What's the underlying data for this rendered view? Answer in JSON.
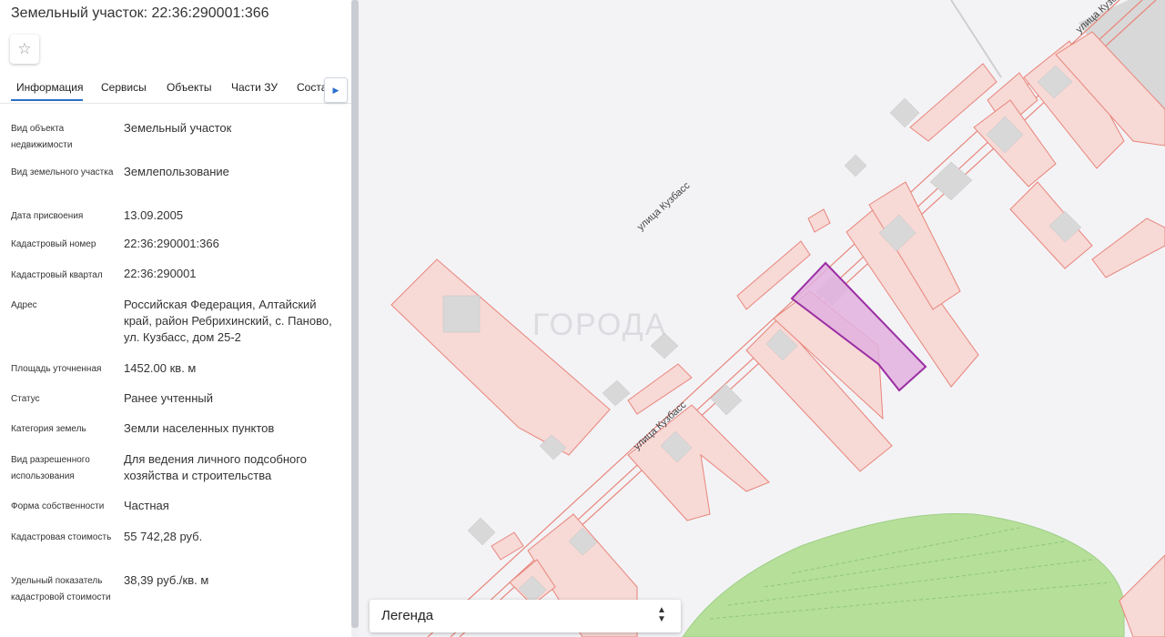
{
  "panel": {
    "title": "Земельный участок: 22:36:290001:366",
    "favorite_icon": "star-icon",
    "tabs": [
      "Информация",
      "Сервисы",
      "Объекты",
      "Части ЗУ",
      "Соста"
    ],
    "tab_scroll_icon": "triangle-right-icon",
    "active_tab": "Информация",
    "fields": [
      {
        "label": "Вид объекта недвижимости",
        "value": "Земельный участок"
      },
      {
        "label": "Вид земельного участка",
        "value": "Землепользование"
      },
      {
        "label": "Дата присвоения",
        "value": "13.09.2005"
      },
      {
        "label": "Кадастровый номер",
        "value": "22:36:290001:366"
      },
      {
        "label": "Кадастровый квартал",
        "value": "22:36:290001"
      },
      {
        "label": "Адрес",
        "value": "Российская Федерация, Алтайский край, район Ребрихинский, с. Паново, ул. Кузбасс, дом 25-2"
      },
      {
        "label": "Площадь уточненная",
        "value": "1452.00 кв. м"
      },
      {
        "label": "Статус",
        "value": "Ранее учтенный"
      },
      {
        "label": "Категория земель",
        "value": "Земли населенных пунктов"
      },
      {
        "label": "Вид разрешенного использования",
        "value": "Для ведения личного подсобного хозяйства и строительства"
      },
      {
        "label": "Форма собственности",
        "value": "Частная"
      },
      {
        "label": "Кадастровая стоимость",
        "value": "55 742,28 руб."
      },
      {
        "label": "Удельный показатель кадастровой стоимости",
        "value": "38,39 руб./кв. м"
      }
    ]
  },
  "map": {
    "street_labels": [
      "улица Кузбасс",
      "улица Кузбасс",
      "улица Кузбасс"
    ],
    "watermark": "ГОРОДА",
    "legend_label": "Легенда",
    "legend_icon": "chevron-up-down-icon",
    "colors": {
      "parcel_fill": "#f7d9d6",
      "parcel_stroke": "#e8857a",
      "selected_fill": "#e2b0df",
      "selected_stroke": "#9b2fa3",
      "building": "#d8d8d8",
      "forest": "#b6df9a",
      "background": "#f3f3f6"
    }
  }
}
